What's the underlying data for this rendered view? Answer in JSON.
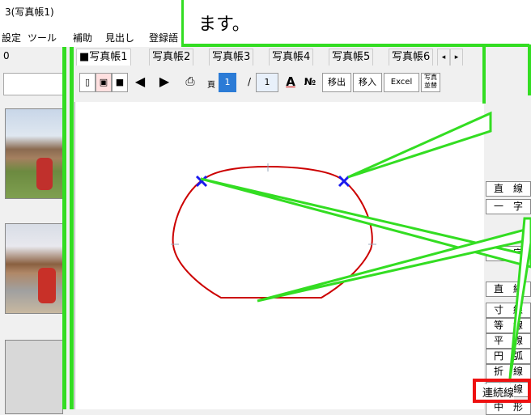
{
  "window": {
    "title": "3(写真帳1)"
  },
  "menu": {
    "items": [
      "設定",
      "ツール",
      "補助",
      "見出し",
      "登録語"
    ]
  },
  "left_panel": {
    "header": "0"
  },
  "tabs": [
    {
      "label": "■写真帳1",
      "active": true
    },
    {
      "label": "写真帳2",
      "active": false
    },
    {
      "label": "写真帳3",
      "active": false
    },
    {
      "label": "写真帳4",
      "active": false
    },
    {
      "label": "写真帳5",
      "active": false
    },
    {
      "label": "写真帳6",
      "active": false
    }
  ],
  "toolbar": {
    "page_label": "頁",
    "page_value": "1",
    "page_separator": "/",
    "page_total": "1",
    "btn_A": "A",
    "btn_no": "№",
    "btn_move_out": "移出",
    "btn_move_in": "移入",
    "btn_excel": "Excel",
    "btn_sort": "写真並替"
  },
  "callout": {
    "text": "ます。"
  },
  "right_panel": {
    "items": [
      "直　線",
      "寸　線",
      "等　線",
      "平　線",
      "円　弧",
      "折　線",
      "連続線",
      "中　形"
    ],
    "partial_top": [
      "直　線",
      "一　字",
      "々　字"
    ]
  },
  "highlighted_button": "連続線",
  "colors": {
    "callout_green": "#33dd22",
    "highlight_red": "#ee1111",
    "shape_red": "#cc0000",
    "marker_blue": "#1a1aee"
  }
}
